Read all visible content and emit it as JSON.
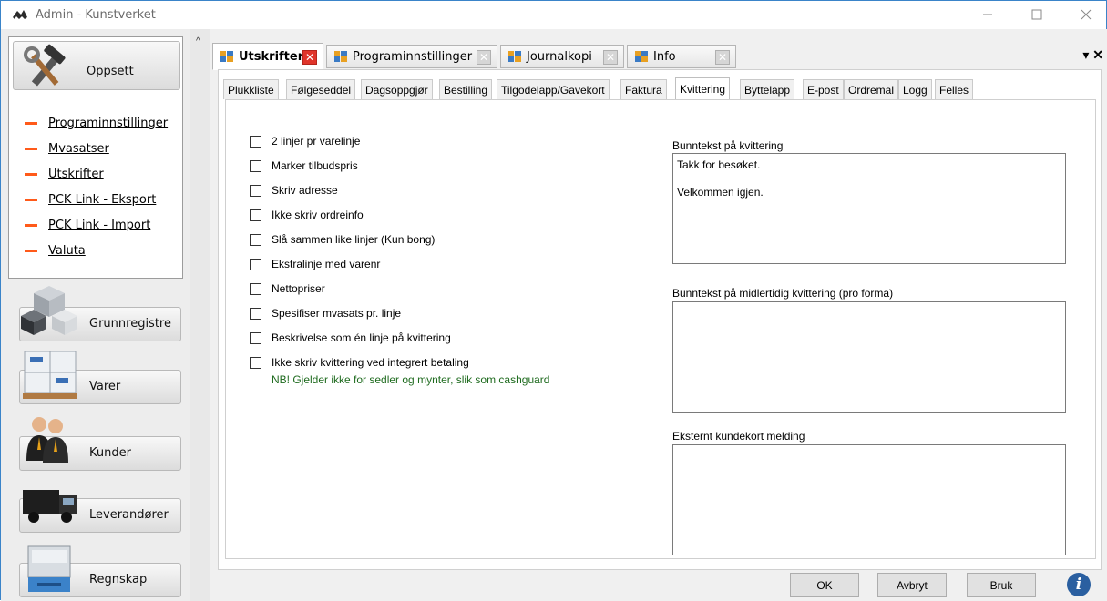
{
  "window": {
    "title": "Admin - Kunstverket",
    "minimize_icon": "minimize-icon",
    "maximize_icon": "maximize-icon",
    "close_icon": "close-icon"
  },
  "sidebar": {
    "oppsett": {
      "label": "Oppsett",
      "icon": "tools-icon"
    },
    "menu_items": [
      {
        "label": "Programinnstillinger"
      },
      {
        "label": "Mvasatser"
      },
      {
        "label": "Utskrifter"
      },
      {
        "label": "PCK Link - Eksport"
      },
      {
        "label": "PCK Link - Import"
      },
      {
        "label": "Valuta"
      }
    ],
    "sections": [
      {
        "label": "Grunnregistre",
        "icon": "cubes-icon"
      },
      {
        "label": "Varer",
        "icon": "boxes-icon"
      },
      {
        "label": "Kunder",
        "icon": "people-icon"
      },
      {
        "label": "Leverandører",
        "icon": "truck-icon"
      },
      {
        "label": "Regnskap",
        "icon": "cash-register-icon"
      }
    ]
  },
  "doc_tabs": [
    {
      "label": "Utskrifter",
      "active": true
    },
    {
      "label": "Programinnstillinger",
      "active": false
    },
    {
      "label": "Journalkopi",
      "active": false
    },
    {
      "label": "Info",
      "active": false
    }
  ],
  "sub_tabs": [
    {
      "label": "Plukkliste"
    },
    {
      "label": "Følgeseddel"
    },
    {
      "label": "Dagsoppgjør"
    },
    {
      "label": "Bestilling"
    },
    {
      "label": "Tilgodelapp/Gavekort"
    },
    {
      "label": "Faktura"
    },
    {
      "label": "Kvittering",
      "active": true
    },
    {
      "label": "Byttelapp"
    },
    {
      "label": "E-post"
    },
    {
      "label": "Ordremal"
    },
    {
      "label": "Logg"
    },
    {
      "label": "Felles"
    }
  ],
  "options": [
    {
      "label": "2 linjer pr varelinje",
      "checked": false
    },
    {
      "label": "Marker tilbudspris",
      "checked": false
    },
    {
      "label": "Skriv adresse",
      "checked": false
    },
    {
      "label": "Ikke skriv ordreinfo",
      "checked": false
    },
    {
      "label": "Slå sammen like linjer (Kun bong)",
      "checked": false
    },
    {
      "label": "Ekstralinje med varenr",
      "checked": false
    },
    {
      "label": "Nettopriser",
      "checked": false
    },
    {
      "label": "Spesifiser mvasats pr. linje",
      "checked": false
    },
    {
      "label": "Beskrivelse som én linje på kvittering",
      "checked": false
    },
    {
      "label": "Ikke skriv kvittering ved integrert betaling",
      "checked": false
    }
  ],
  "note": "NB! Gjelder ikke for sedler og mynter, slik som cashguard",
  "fields": {
    "bunntekst": {
      "label": "Bunntekst på kvittering",
      "value": "Takk for besøket.\n\nVelkommen igjen."
    },
    "midlertidig": {
      "label": "Bunntekst på midlertidig kvittering (pro forma)",
      "value": ""
    },
    "eksternt": {
      "label": "Eksternt kundekort melding",
      "value": ""
    }
  },
  "buttons": {
    "ok": "OK",
    "cancel": "Avbryt",
    "apply": "Bruk",
    "info_icon": "info-icon"
  },
  "colors": {
    "accent_dash": "#ff5a1a",
    "note_green": "#1f6b1f",
    "close_red": "#e0352b"
  }
}
